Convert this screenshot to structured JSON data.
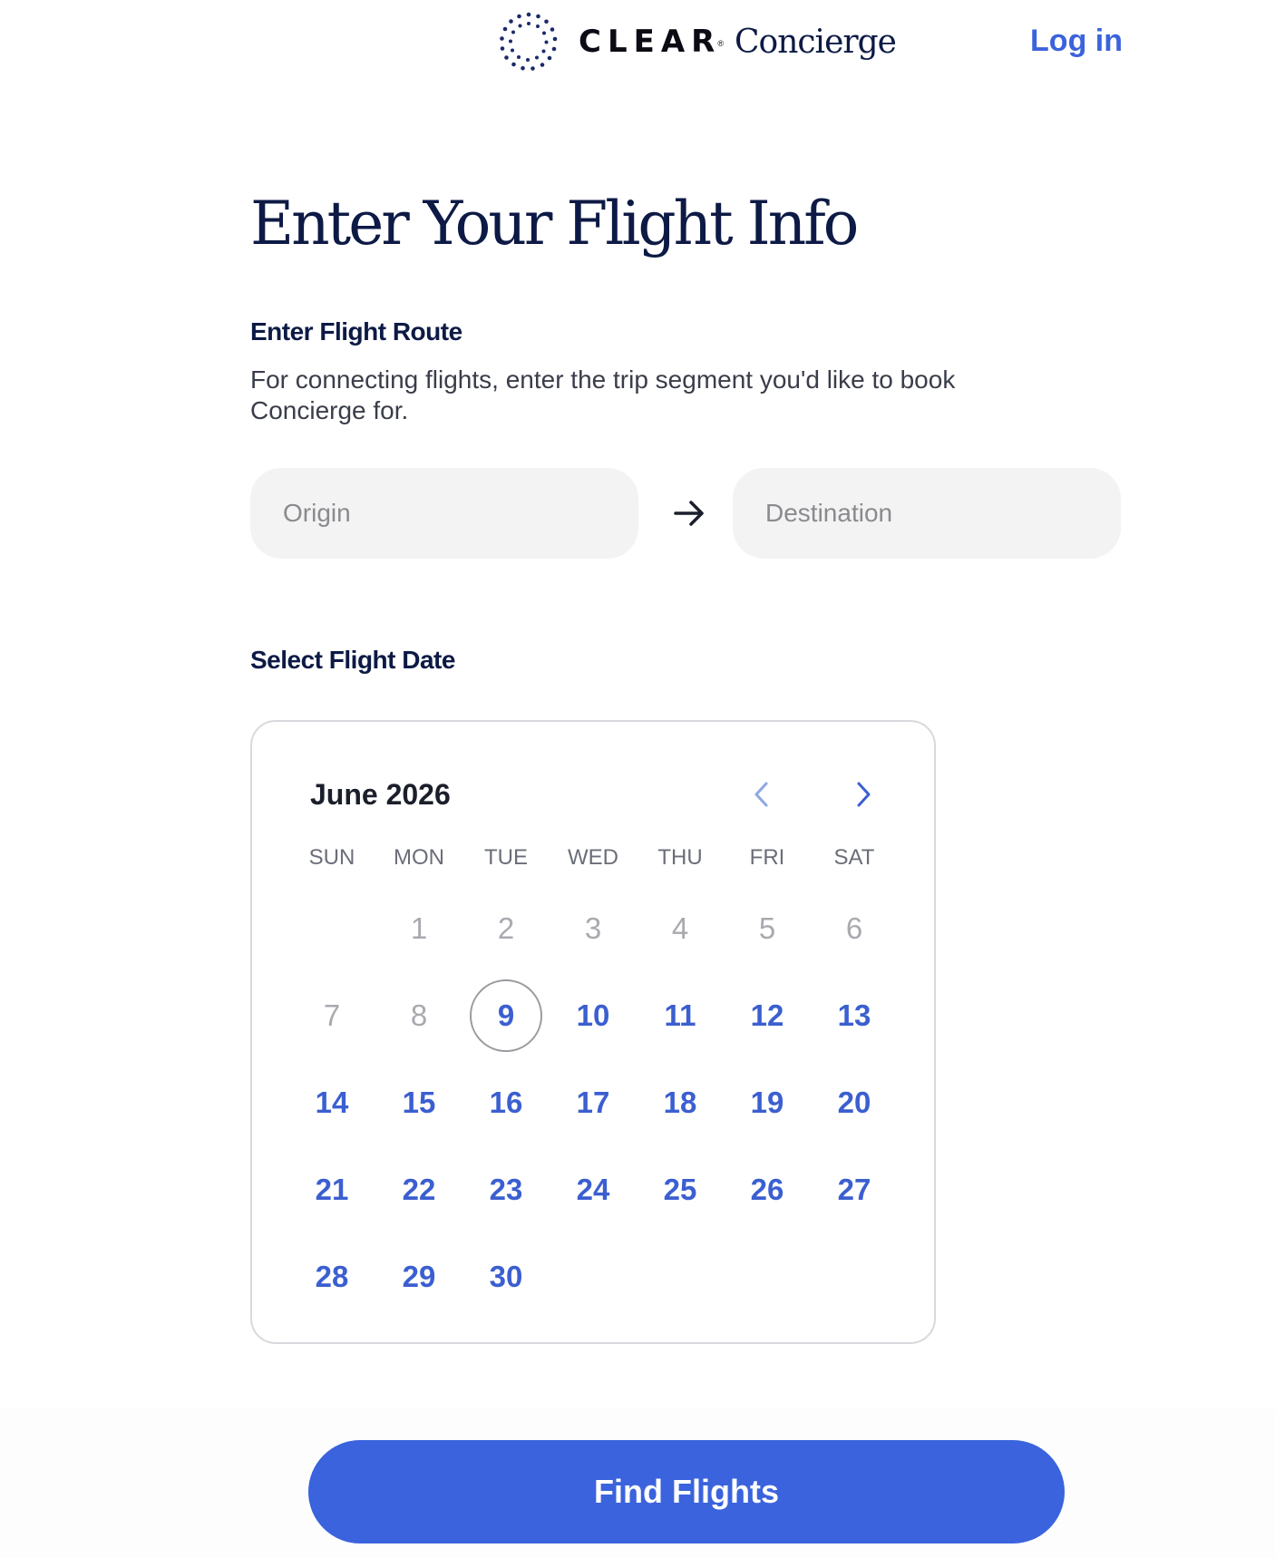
{
  "header": {
    "brand_name": "CLEAR",
    "brand_reg": "®",
    "brand_product": "Concierge",
    "login_label": "Log in"
  },
  "main": {
    "title": "Enter Your Flight Info",
    "route_section": {
      "label": "Enter Flight Route",
      "help_text": "For connecting flights, enter the trip segment you'd like to book Concierge for.",
      "origin_placeholder": "Origin",
      "origin_value": "",
      "destination_placeholder": "Destination",
      "destination_value": "",
      "arrow_icon": "arrow-right-icon"
    },
    "date_section": {
      "label": "Select Flight Date"
    }
  },
  "calendar": {
    "month_label": "June 2026",
    "prev_icon": "chevron-left-icon",
    "next_icon": "chevron-right-icon",
    "weekdays": [
      "SUN",
      "MON",
      "TUE",
      "WED",
      "THU",
      "FRI",
      "SAT"
    ],
    "leading_blank_days": 1,
    "days": [
      {
        "label": "1",
        "disabled": true
      },
      {
        "label": "2",
        "disabled": true
      },
      {
        "label": "3",
        "disabled": true
      },
      {
        "label": "4",
        "disabled": true
      },
      {
        "label": "5",
        "disabled": true
      },
      {
        "label": "6",
        "disabled": true
      },
      {
        "label": "7",
        "disabled": true
      },
      {
        "label": "8",
        "disabled": true
      },
      {
        "label": "9",
        "disabled": false,
        "today": true
      },
      {
        "label": "10",
        "disabled": false
      },
      {
        "label": "11",
        "disabled": false
      },
      {
        "label": "12",
        "disabled": false
      },
      {
        "label": "13",
        "disabled": false
      },
      {
        "label": "14",
        "disabled": false
      },
      {
        "label": "15",
        "disabled": false
      },
      {
        "label": "16",
        "disabled": false
      },
      {
        "label": "17",
        "disabled": false
      },
      {
        "label": "18",
        "disabled": false
      },
      {
        "label": "19",
        "disabled": false
      },
      {
        "label": "20",
        "disabled": false
      },
      {
        "label": "21",
        "disabled": false
      },
      {
        "label": "22",
        "disabled": false
      },
      {
        "label": "23",
        "disabled": false
      },
      {
        "label": "24",
        "disabled": false
      },
      {
        "label": "25",
        "disabled": false
      },
      {
        "label": "26",
        "disabled": false
      },
      {
        "label": "27",
        "disabled": false
      },
      {
        "label": "28",
        "disabled": false
      },
      {
        "label": "29",
        "disabled": false
      },
      {
        "label": "30",
        "disabled": false
      }
    ]
  },
  "footer": {
    "find_button_label": "Find Flights"
  },
  "colors": {
    "accent": "#3a63dd",
    "navy": "#0d1a45",
    "field_bg": "#f3f3f3",
    "disabled_day": "#a9aab0",
    "enabled_day": "#3b5fd0"
  }
}
